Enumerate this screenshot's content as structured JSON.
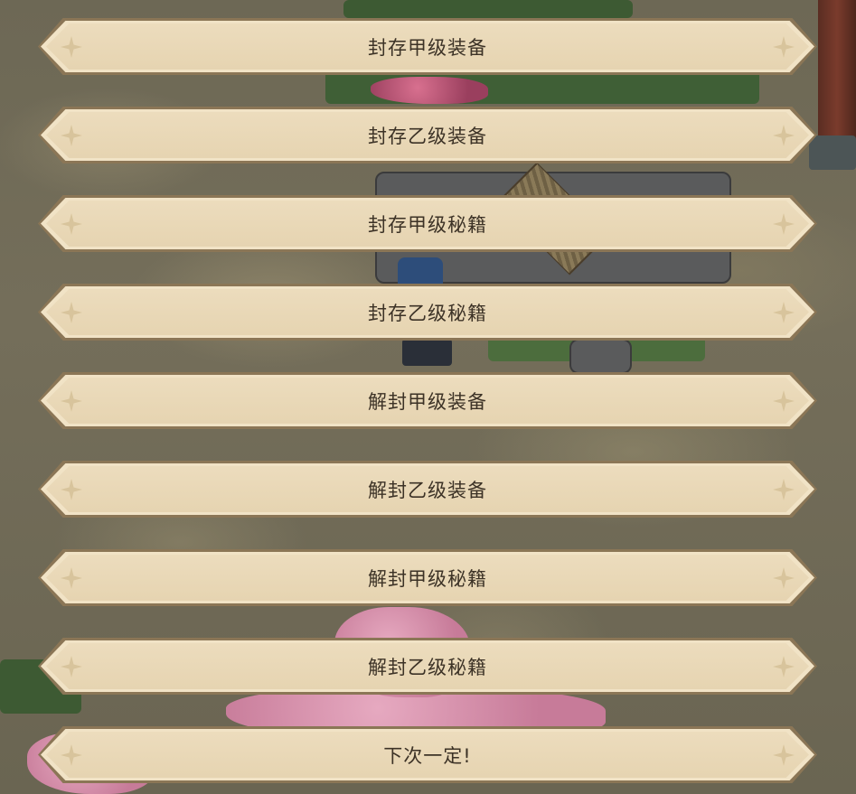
{
  "dialog": {
    "options": [
      {
        "label": "封存甲级装备"
      },
      {
        "label": "封存乙级装备"
      },
      {
        "label": "封存甲级秘籍"
      },
      {
        "label": "封存乙级秘籍"
      },
      {
        "label": "解封甲级装备"
      },
      {
        "label": "解封乙级装备"
      },
      {
        "label": "解封甲级秘籍"
      },
      {
        "label": "解封乙级秘籍"
      },
      {
        "label": "下次一定!"
      }
    ],
    "ornament_icon": "four-point-star-icon"
  },
  "colors": {
    "button_fill": "#e6d4b1",
    "button_border": "#8b7656",
    "button_highlight": "#f1e3c6",
    "label_text": "#3c3226",
    "ornament": "#d8c49c"
  }
}
